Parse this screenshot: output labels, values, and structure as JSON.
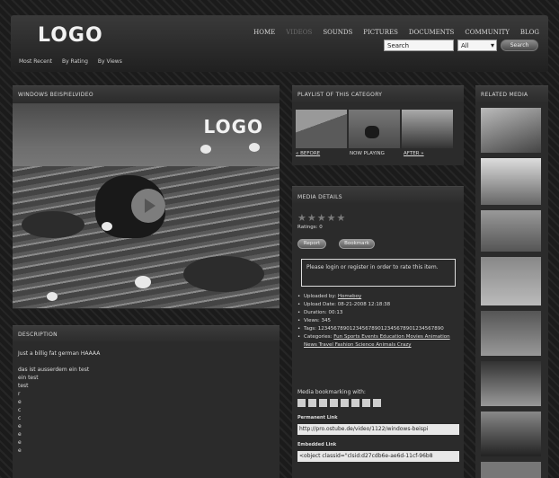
{
  "header": {
    "logo": "LOGO",
    "nav": [
      "HOME",
      "VIDEOS",
      "SOUNDS",
      "PICTURES",
      "DOCUMENTS",
      "COMMUNITY",
      "BLOG"
    ],
    "subnav": [
      "Most Recent",
      "By Rating",
      "By Views"
    ],
    "search_value": "Search",
    "select_value": "All",
    "go_label": "Search"
  },
  "video": {
    "title": "WINDOWS BEISPIELVIDEO",
    "overlay_logo": "LOGO"
  },
  "description": {
    "title": "DESCRIPTION",
    "lines": [
      "Just a billig fat german HAAAA",
      "",
      "das ist ausserdem ein test",
      "ein test",
      "test",
      "r",
      "e",
      "c",
      "c",
      "e",
      "e",
      "e",
      "e"
    ]
  },
  "playlist": {
    "title": "PLAYLIST OF THIS CATEGORY",
    "before": "« BEFORE",
    "now": "NOW PLAYING",
    "after": "AFTER »"
  },
  "details": {
    "title": "MEDIA DETAILS",
    "stars": "★★★★★",
    "ratings": "Ratings: 0",
    "report": "Report",
    "bookmark": "Bookmark",
    "login_msg": "Please login or register in order to rate this item.",
    "uploaded_by_label": "Uploaded by:",
    "uploaded_by": "Homeboy",
    "upload_date": "Upload Date: 08-21-2008 12:18:38",
    "duration": "Duration: 00:13",
    "views": "Views: 345",
    "tags": "Tags: 1234567890123456789012345678901234567890",
    "categories_label": "Categories:",
    "categories": "Fun Sports Events Education Movies Animation News Travel Fashion Science Animals Crazy",
    "bookmarking_label": "Media bookmarking with:",
    "permanent_label": "Permanent Link",
    "permanent_link": "http://pro.ostube.de/video/1122/windows-beispi",
    "embedded_label": "Embedded Link",
    "embedded_link": "<object classid=\"clsid:d27cdb6e-ae6d-11cf-96b8"
  },
  "related": {
    "title": "RELATED MEDIA",
    "thumb_count_note": ""
  }
}
